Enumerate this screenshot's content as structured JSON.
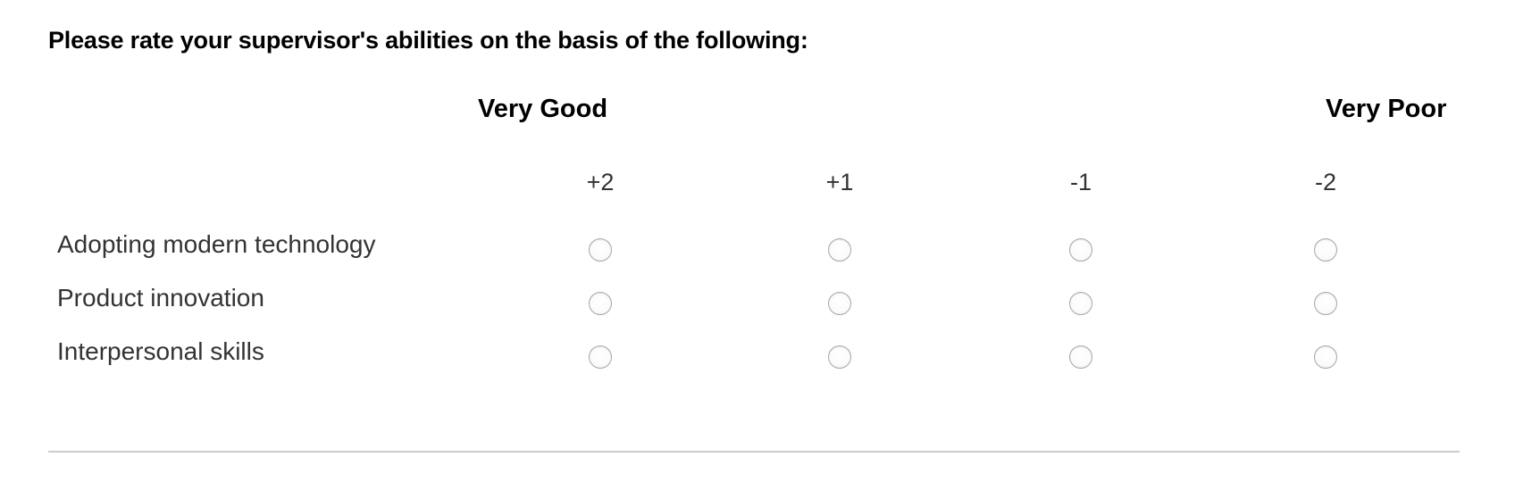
{
  "question": {
    "text": "Please rate your supervisor's abilities on the basis of the following:"
  },
  "anchors": {
    "left": "Very Good",
    "right": "Very Poor"
  },
  "scale": [
    "+2",
    "+1",
    "-1",
    "-2"
  ],
  "rows": [
    {
      "label": "Adopting modern technology",
      "selected": null
    },
    {
      "label": "Product innovation",
      "selected": null
    },
    {
      "label": "Interpersonal skills",
      "selected": null
    }
  ],
  "colors": {
    "radio_border": "#a8a8a8",
    "divider": "#cccccc",
    "label_text": "#333333"
  }
}
